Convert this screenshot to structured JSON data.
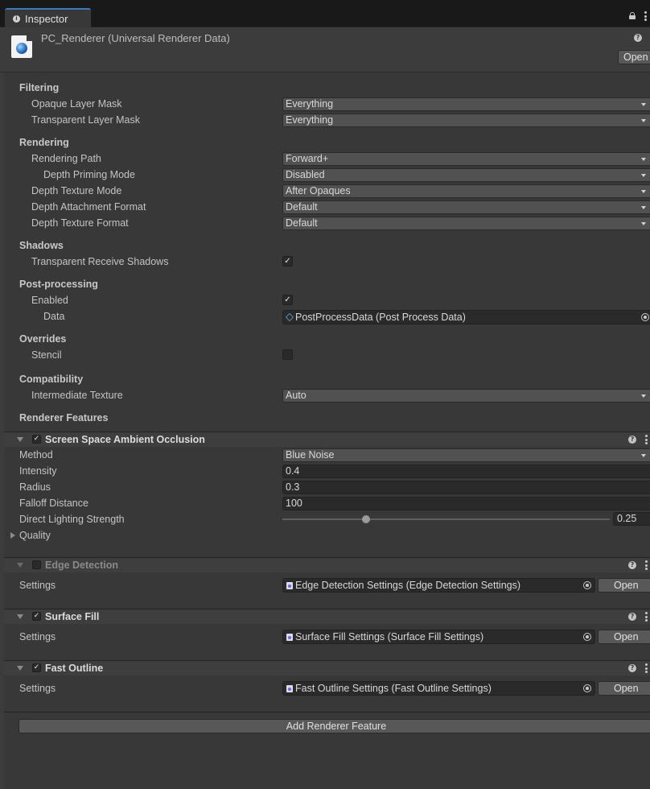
{
  "tab": {
    "label": "Inspector",
    "info_icon": "info-icon"
  },
  "header": {
    "title": "PC_Renderer (Universal Renderer Data)",
    "open_label": "Open",
    "help_glyph": "?"
  },
  "filtering": {
    "title": "Filtering",
    "opaque_label": "Opaque Layer Mask",
    "opaque_value": "Everything",
    "transparent_label": "Transparent Layer Mask",
    "transparent_value": "Everything"
  },
  "rendering": {
    "title": "Rendering",
    "path_label": "Rendering Path",
    "path_value": "Forward+",
    "priming_label": "Depth Priming Mode",
    "priming_value": "Disabled",
    "texture_mode_label": "Depth Texture Mode",
    "texture_mode_value": "After Opaques",
    "attachment_label": "Depth Attachment Format",
    "attachment_value": "Default",
    "texture_format_label": "Depth Texture Format",
    "texture_format_value": "Default"
  },
  "shadows": {
    "title": "Shadows",
    "receive_label": "Transparent Receive Shadows",
    "receive_checked": true
  },
  "postprocessing": {
    "title": "Post-processing",
    "enabled_label": "Enabled",
    "enabled_checked": true,
    "data_label": "Data",
    "data_value": "PostProcessData (Post Process Data)"
  },
  "overrides": {
    "title": "Overrides",
    "stencil_label": "Stencil",
    "stencil_checked": false
  },
  "compatibility": {
    "title": "Compatibility",
    "intermediate_label": "Intermediate Texture",
    "intermediate_value": "Auto"
  },
  "renderer_features": {
    "title": "Renderer Features",
    "ssao": {
      "title": "Screen Space Ambient Occlusion",
      "enabled": true,
      "method_label": "Method",
      "method_value": "Blue Noise",
      "intensity_label": "Intensity",
      "intensity_value": "0.4",
      "radius_label": "Radius",
      "radius_value": "0.3",
      "falloff_label": "Falloff Distance",
      "falloff_value": "100",
      "direct_label": "Direct Lighting Strength",
      "direct_value": "0.25",
      "direct_fraction": 0.25,
      "quality_label": "Quality"
    },
    "edge": {
      "title": "Edge Detection",
      "enabled": false,
      "settings_label": "Settings",
      "settings_value": "Edge Detection Settings (Edge Detection Settings)",
      "open_label": "Open"
    },
    "fill": {
      "title": "Surface Fill",
      "enabled": true,
      "settings_label": "Settings",
      "settings_value": "Surface Fill Settings (Surface Fill Settings)",
      "open_label": "Open"
    },
    "outline": {
      "title": "Fast Outline",
      "enabled": true,
      "settings_label": "Settings",
      "settings_value": "Fast Outline Settings (Fast Outline Settings)",
      "open_label": "Open"
    },
    "add_label": "Add Renderer Feature"
  },
  "check_glyph": "✓",
  "colors": {
    "background": "#383838",
    "tab_accent": "#3a79bb",
    "field": "#2a2a2a",
    "dropdown": "#515151",
    "button": "#585858"
  }
}
